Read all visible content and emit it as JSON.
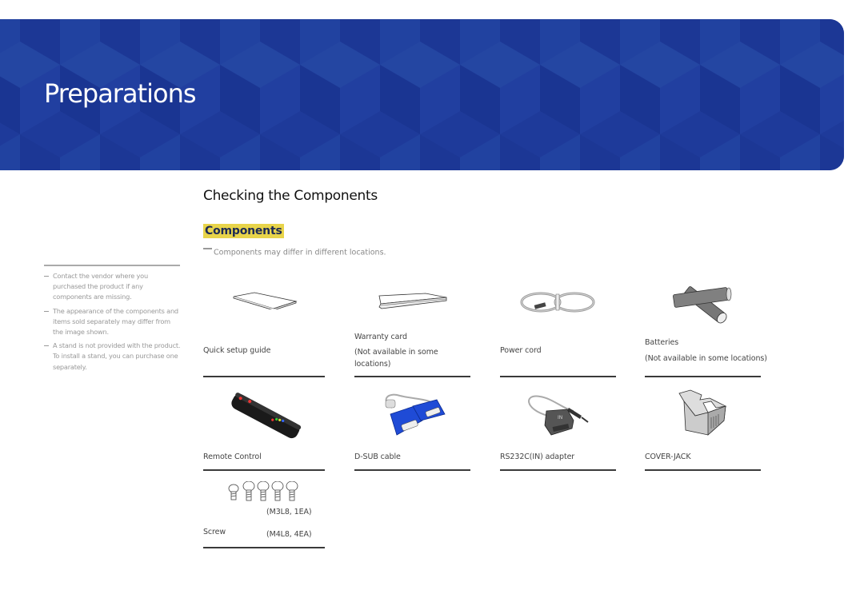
{
  "header": {
    "title": "Preparations",
    "banner_color": "#1e3a9a"
  },
  "section": {
    "title": "Checking the Components",
    "subtitle": "Components",
    "subtitle_highlight": "#e8d44a",
    "note": "Components may differ in different locations."
  },
  "sidebar": {
    "notes": [
      "Contact the vendor where you purchased the product if any components are missing.",
      "The appearance of the components and items sold separately may differ from the image shown.",
      "A stand is not provided with the product. To install a stand, you can purchase one separately."
    ]
  },
  "components": [
    {
      "name": "Quick setup guide",
      "note": "",
      "icon": "booklet-icon"
    },
    {
      "name": "Warranty card",
      "note": "(Not available in some locations)",
      "icon": "card-icon"
    },
    {
      "name": "Power cord",
      "note": "",
      "icon": "power-cord-icon"
    },
    {
      "name": "Batteries",
      "note": "(Not available in some locations)",
      "icon": "batteries-icon"
    },
    {
      "name": "Remote Control",
      "note": "",
      "icon": "remote-control-icon"
    },
    {
      "name": "D-SUB cable",
      "note": "",
      "icon": "dsub-cable-icon"
    },
    {
      "name": "RS232C(IN) adapter",
      "note": "",
      "icon": "rs232c-adapter-icon"
    },
    {
      "name": "COVER-JACK",
      "note": "",
      "icon": "cover-jack-icon"
    },
    {
      "name": "Screw",
      "note": "",
      "icon": "screws-icon",
      "specs": [
        "(M3L8, 1EA)",
        "(M4L8, 4EA)"
      ]
    }
  ]
}
